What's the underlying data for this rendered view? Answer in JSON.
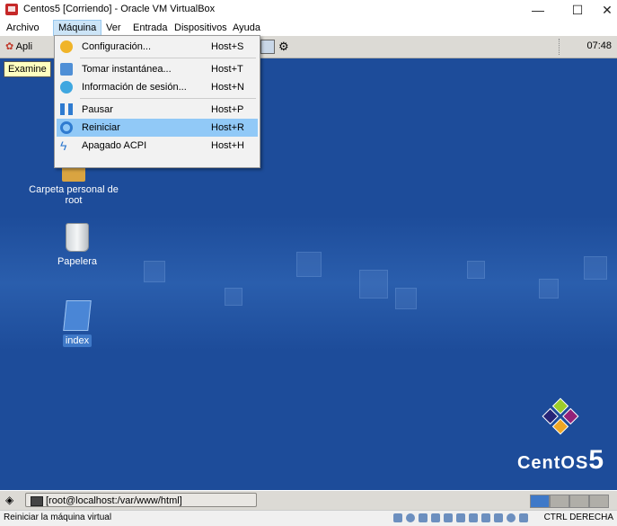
{
  "window": {
    "title": "Centos5 [Corriendo] - Oracle VM VirtualBox"
  },
  "window_controls": {
    "minimize": "—",
    "maximize": "☐",
    "close": "✕"
  },
  "menubar": [
    "Archivo",
    "Máquina",
    "Ver",
    "Entrada",
    "Dispositivos",
    "Ayuda"
  ],
  "machine_menu": [
    {
      "label": "Configuración...",
      "shortcut": "Host+S",
      "icon": "gear-icon"
    },
    {
      "label": "Tomar instantánea...",
      "shortcut": "Host+T",
      "icon": "camera-icon"
    },
    {
      "label": "Información de sesión...",
      "shortcut": "Host+N",
      "icon": "info-icon"
    },
    {
      "label": "Pausar",
      "shortcut": "Host+P",
      "icon": "pause-icon"
    },
    {
      "label": "Reiniciar",
      "shortcut": "Host+R",
      "icon": "reset-icon",
      "highlighted": true
    },
    {
      "label": "Apagado ACPI",
      "shortcut": "Host+H",
      "icon": "power-icon"
    }
  ],
  "guest": {
    "panel_apps_label": "Apli",
    "clock": "07:48",
    "tooltip": "Examine",
    "desktop_icons": [
      {
        "label": "Carpeta personal de root",
        "icon": "home-folder-icon"
      },
      {
        "label": "Papelera",
        "icon": "trash-icon"
      },
      {
        "label": "index",
        "icon": "document-icon",
        "selected": true
      }
    ],
    "logo_text": "CentOS",
    "logo_number": "5",
    "taskbar_window": "[root@localhost:/var/www/html]"
  },
  "statusbar": {
    "message": "Reiniciar la máquina virtual",
    "host_key": "CTRL DERECHA"
  },
  "colors": {
    "guest_bg": "#1d4c9a",
    "menu_highlight": "#91c9f7",
    "menubar_active": "#cce4f7"
  }
}
